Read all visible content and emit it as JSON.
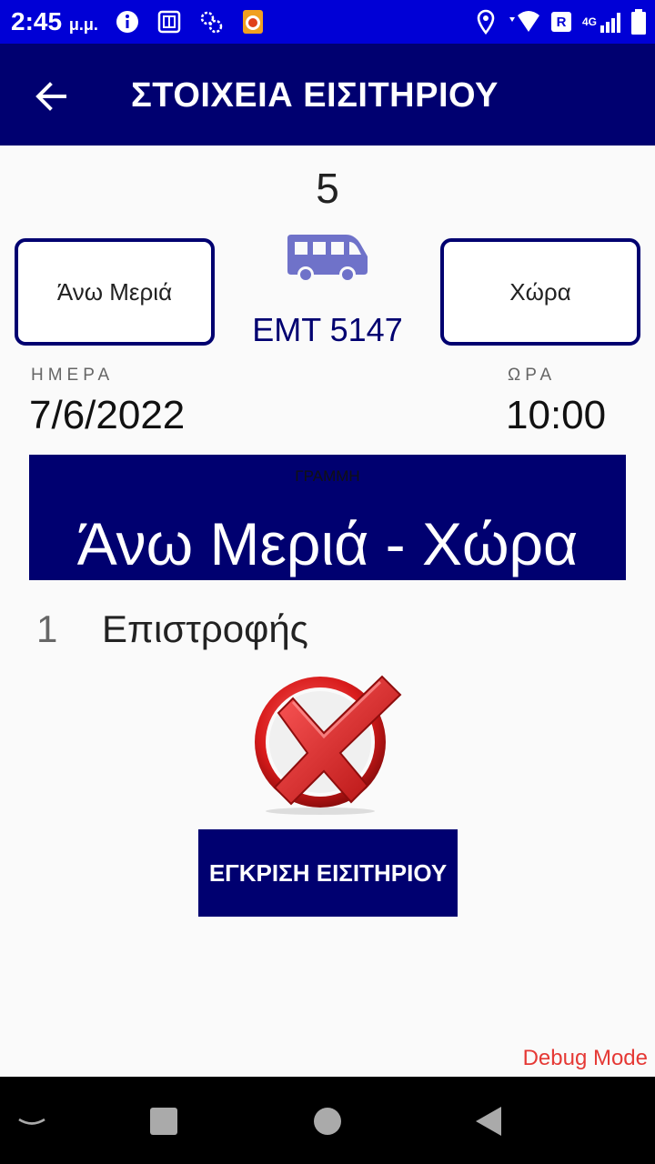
{
  "status_bar": {
    "time": "2:45",
    "period": "μ.μ.",
    "network": "4G",
    "roaming": "R"
  },
  "app_bar": {
    "title": "ΣΤΟΙΧΕΙΑ ΕΙΣΙΤΗΡΙΟΥ",
    "back_icon": "arrow-back-icon"
  },
  "ticket": {
    "seat_number": "5",
    "from_stop": "Άνω Μεριά",
    "to_stop": "Χώρα",
    "vehicle_plate": "EMT 5147",
    "day_label": "ΗΜΕΡΑ",
    "day_value": "7/6/2022",
    "time_label": "ΩΡΑ",
    "time_value": "10:00",
    "line_label": "ΓΡΑΜΜΗ",
    "line_value": "Άνω Μεριά - Χώρα",
    "count": "1",
    "type": "Επιστροφής",
    "status_icon": "red-x-icon"
  },
  "actions": {
    "approve_label": "ΕΓΚΡΙΣΗ ΕΙΣΙΤΗΡΙΟΥ"
  },
  "debug_label": "Debug Mode",
  "colors": {
    "status_bar": "#0000d6",
    "primary": "#000070",
    "bus_icon": "#6f72c9",
    "debug": "#e53935"
  }
}
